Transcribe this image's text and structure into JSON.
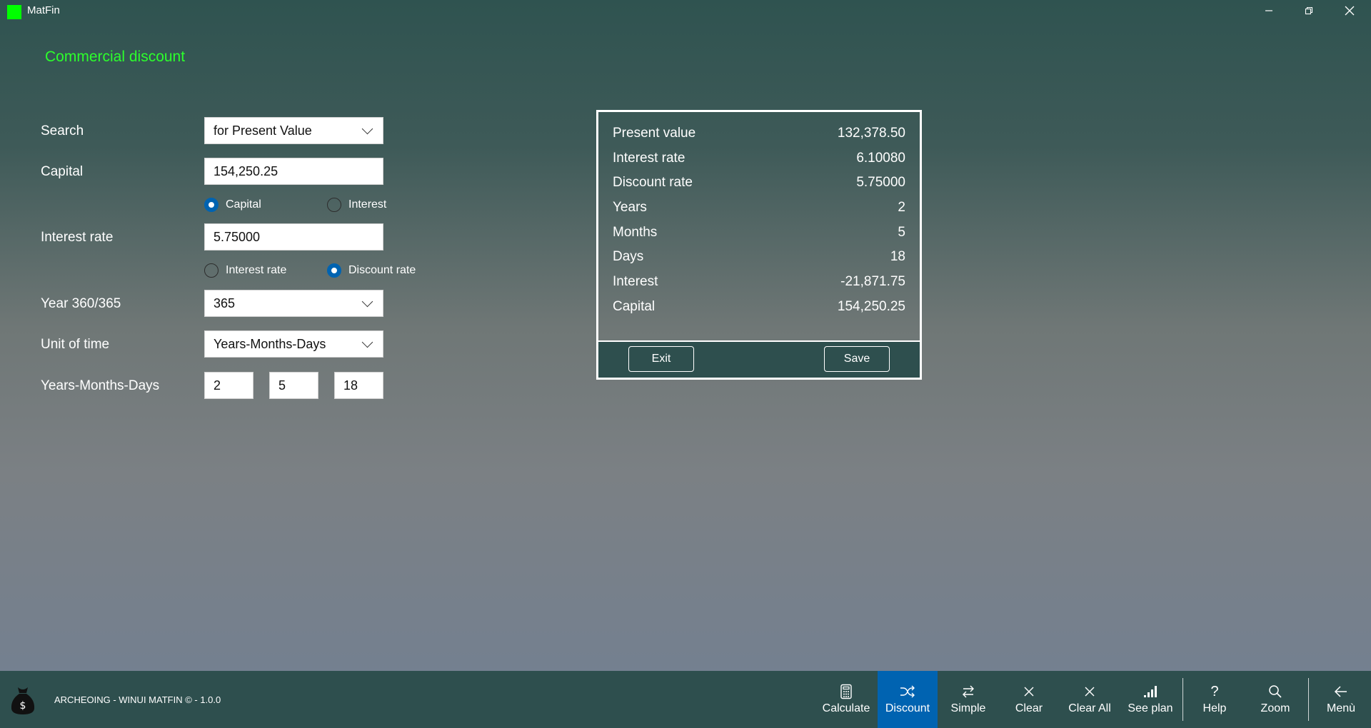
{
  "window": {
    "title": "MatFin",
    "controls": [
      "minimize",
      "restore",
      "close"
    ]
  },
  "page": {
    "title": "Commercial discount"
  },
  "form": {
    "search": {
      "label": "Search",
      "value": "for Present Value"
    },
    "capital": {
      "label": "Capital",
      "value": "154,250.25"
    },
    "capital_mode": {
      "options": [
        {
          "label": "Capital",
          "selected": true
        },
        {
          "label": "Interest",
          "selected": false
        }
      ]
    },
    "interest_rate": {
      "label": "Interest rate",
      "value": "5.75000"
    },
    "rate_mode": {
      "options": [
        {
          "label": "Interest rate",
          "selected": false
        },
        {
          "label": "Discount rate",
          "selected": true
        }
      ]
    },
    "year_basis": {
      "label": "Year 360/365",
      "value": "365"
    },
    "unit_of_time": {
      "label": "Unit of time",
      "value": "Years-Months-Days"
    },
    "ymd": {
      "label": "Years-Months-Days",
      "years": "2",
      "months": "5",
      "days": "18"
    }
  },
  "results": {
    "rows": [
      {
        "label": "Present value",
        "value": "132,378.50"
      },
      {
        "label": "Interest rate",
        "value": "6.10080"
      },
      {
        "label": "Discount rate",
        "value": "5.75000"
      },
      {
        "label": "Years",
        "value": "2"
      },
      {
        "label": "Months",
        "value": "5"
      },
      {
        "label": "Days",
        "value": "18"
      },
      {
        "label": "Interest",
        "value": "-21,871.75"
      },
      {
        "label": "Capital",
        "value": "154,250.25"
      }
    ],
    "exit_label": "Exit",
    "save_label": "Save"
  },
  "footer": {
    "text": "ARCHEOING - WINUI MATFIN © - 1.0.0"
  },
  "toolbar": {
    "buttons": [
      {
        "label": "Calculate",
        "icon": "calculator-icon",
        "active": false
      },
      {
        "label": "Discount",
        "icon": "shuffle-icon",
        "active": true
      },
      {
        "label": "Simple",
        "icon": "swap-arrows-icon",
        "active": false
      },
      {
        "label": "Clear",
        "icon": "close-icon",
        "active": false
      },
      {
        "label": "Clear All",
        "icon": "close-icon",
        "active": false
      },
      {
        "label": "See plan",
        "icon": "bar-chart-icon",
        "active": false
      },
      {
        "label": "Help",
        "icon": "question-icon",
        "active": false
      },
      {
        "label": "Zoom",
        "icon": "search-icon",
        "active": false
      },
      {
        "label": "Menù",
        "icon": "back-arrow-icon",
        "active": false
      }
    ]
  },
  "colors": {
    "accent": "#0063b1",
    "title_green": "#2cff2c",
    "bar_background": "#2e4f4e",
    "app_icon": "#00ff00"
  }
}
